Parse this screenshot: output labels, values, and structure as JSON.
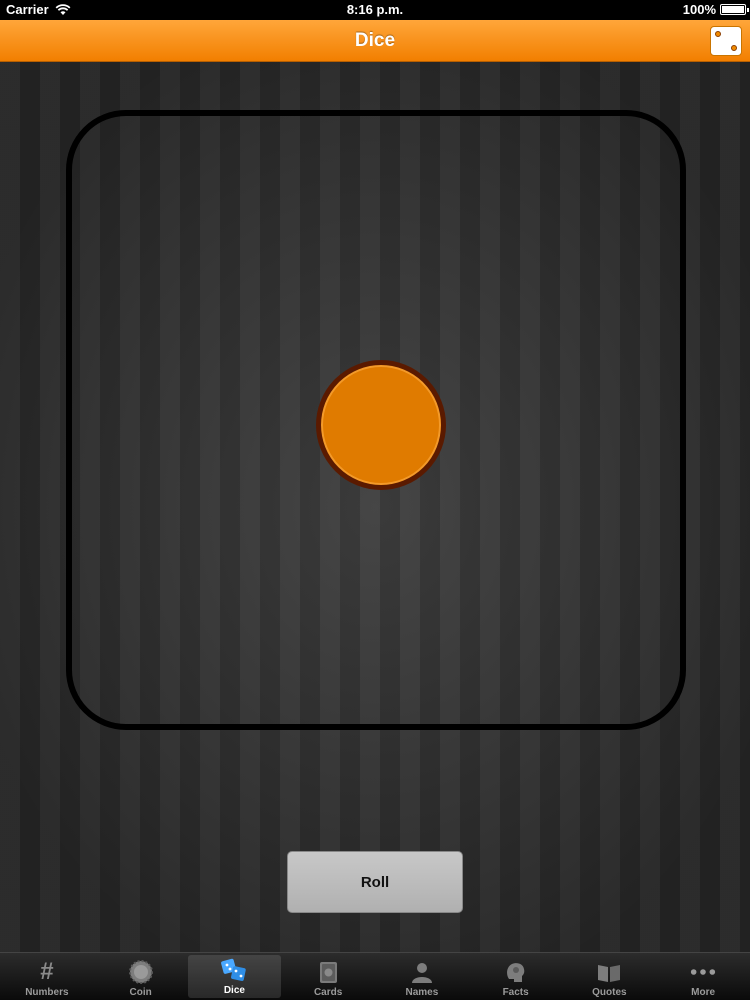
{
  "status_bar": {
    "carrier": "Carrier",
    "time": "8:16 p.m.",
    "battery": "100%"
  },
  "nav_bar": {
    "title": "Dice"
  },
  "main": {
    "die_value": 1,
    "roll_label": "Roll"
  },
  "colors": {
    "accent": "#f28500",
    "pip": "#e07b00",
    "pip_border": "#5a1a00"
  },
  "tabs": [
    {
      "label": "Numbers",
      "icon": "hash-icon"
    },
    {
      "label": "Coin",
      "icon": "coin-icon"
    },
    {
      "label": "Dice",
      "icon": "dice-icon",
      "active": true
    },
    {
      "label": "Cards",
      "icon": "cards-icon"
    },
    {
      "label": "Names",
      "icon": "person-icon"
    },
    {
      "label": "Facts",
      "icon": "brain-icon"
    },
    {
      "label": "Quotes",
      "icon": "book-icon"
    },
    {
      "label": "More",
      "icon": "more-icon"
    }
  ]
}
